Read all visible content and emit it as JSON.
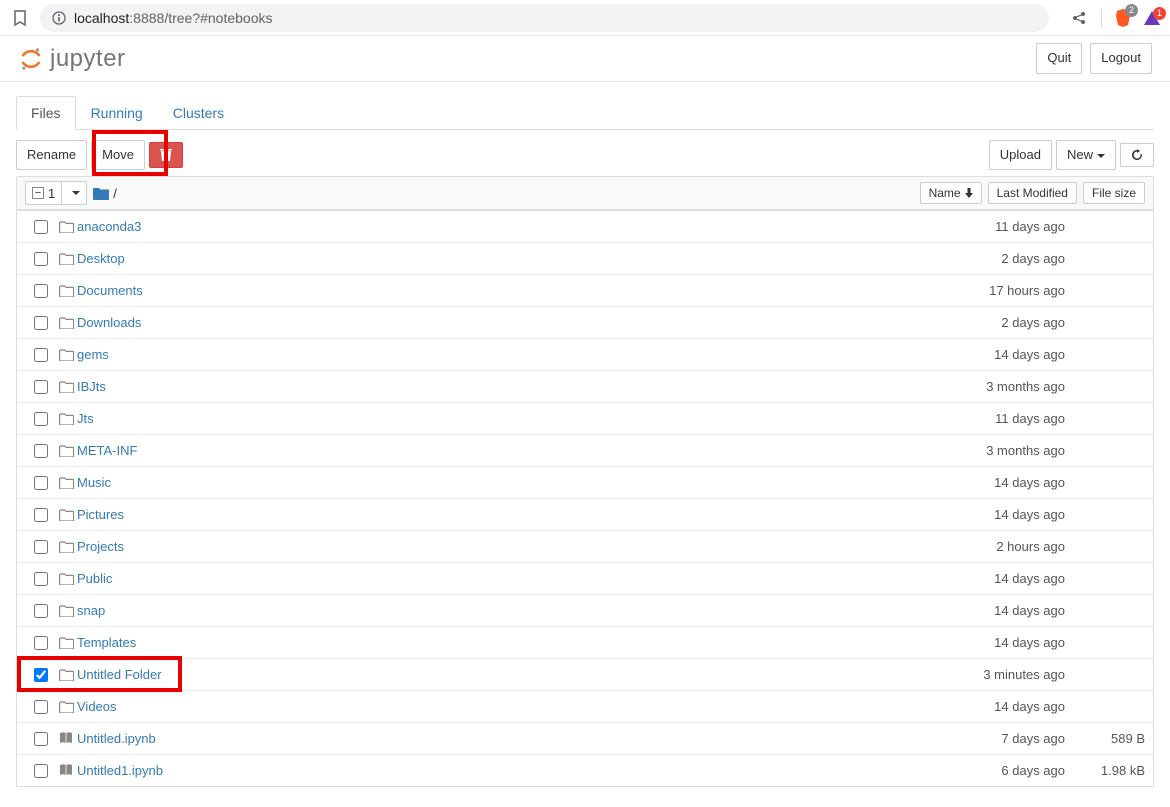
{
  "browser": {
    "url_prefix": "localhost",
    "url_port": ":8888",
    "url_path": "/tree?#notebooks",
    "brave_badge": "2",
    "alert_badge": "1"
  },
  "header": {
    "brand": "jupyter",
    "quit": "Quit",
    "logout": "Logout"
  },
  "tabs": {
    "files": "Files",
    "running": "Running",
    "clusters": "Clusters"
  },
  "toolbar": {
    "rename": "Rename",
    "move": "Move",
    "upload": "Upload",
    "new": "New"
  },
  "list_header": {
    "selected_count": "1",
    "breadcrumb_root": "/",
    "name": "Name",
    "last_modified": "Last Modified",
    "file_size": "File size"
  },
  "files": [
    {
      "name": "anaconda3",
      "type": "folder",
      "modified": "11 days ago",
      "size": "",
      "checked": false
    },
    {
      "name": "Desktop",
      "type": "folder",
      "modified": "2 days ago",
      "size": "",
      "checked": false
    },
    {
      "name": "Documents",
      "type": "folder",
      "modified": "17 hours ago",
      "size": "",
      "checked": false
    },
    {
      "name": "Downloads",
      "type": "folder",
      "modified": "2 days ago",
      "size": "",
      "checked": false
    },
    {
      "name": "gems",
      "type": "folder",
      "modified": "14 days ago",
      "size": "",
      "checked": false
    },
    {
      "name": "IBJts",
      "type": "folder",
      "modified": "3 months ago",
      "size": "",
      "checked": false
    },
    {
      "name": "Jts",
      "type": "folder",
      "modified": "11 days ago",
      "size": "",
      "checked": false
    },
    {
      "name": "META-INF",
      "type": "folder",
      "modified": "3 months ago",
      "size": "",
      "checked": false
    },
    {
      "name": "Music",
      "type": "folder",
      "modified": "14 days ago",
      "size": "",
      "checked": false
    },
    {
      "name": "Pictures",
      "type": "folder",
      "modified": "14 days ago",
      "size": "",
      "checked": false
    },
    {
      "name": "Projects",
      "type": "folder",
      "modified": "2 hours ago",
      "size": "",
      "checked": false
    },
    {
      "name": "Public",
      "type": "folder",
      "modified": "14 days ago",
      "size": "",
      "checked": false
    },
    {
      "name": "snap",
      "type": "folder",
      "modified": "14 days ago",
      "size": "",
      "checked": false
    },
    {
      "name": "Templates",
      "type": "folder",
      "modified": "14 days ago",
      "size": "",
      "checked": false
    },
    {
      "name": "Untitled Folder",
      "type": "folder",
      "modified": "3 minutes ago",
      "size": "",
      "checked": true
    },
    {
      "name": "Videos",
      "type": "folder",
      "modified": "14 days ago",
      "size": "",
      "checked": false
    },
    {
      "name": "Untitled.ipynb",
      "type": "notebook",
      "modified": "7 days ago",
      "size": "589 B",
      "checked": false
    },
    {
      "name": "Untitled1.ipynb",
      "type": "notebook",
      "modified": "6 days ago",
      "size": "1.98 kB",
      "checked": false
    }
  ]
}
